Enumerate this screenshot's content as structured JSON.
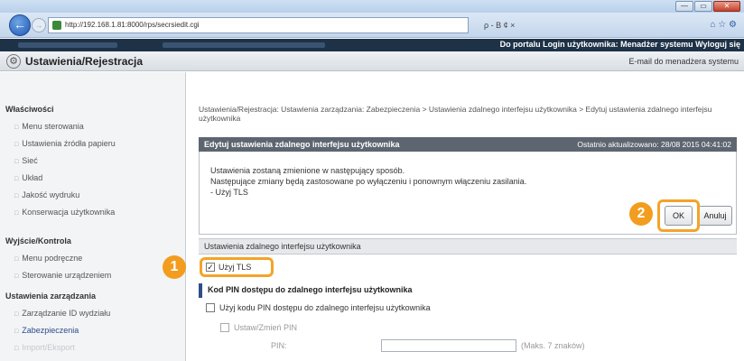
{
  "browser": {
    "url": "http://192.168.1.81:8000/rps/secrsiedit.cgi",
    "search_glyphs": "ρ - B ¢ ×",
    "tab_glyphs": "⌂ ☆ ⚙",
    "window_minimize": "—",
    "window_maximize": "▭",
    "window_close": "✕",
    "back": "←",
    "forward": "→"
  },
  "topbar": {
    "links": "Do portalu  Login użytkownika: Menadżer systemu  Wyloguj się"
  },
  "header": {
    "title": "Ustawienia/Rejestracja",
    "email_link": "E-mail do menadżera systemu"
  },
  "sidebar": {
    "sections": [
      {
        "heading": "Właściwości",
        "items": [
          "Menu sterowania",
          "Ustawienia źródła papieru",
          "Sieć",
          "Układ",
          "Jakość wydruku",
          "Konserwacja użytkownika"
        ]
      },
      {
        "heading": "Wyjście/Kontrola",
        "items": [
          "Menu podręczne",
          "Sterowanie urządzeniem"
        ]
      },
      {
        "heading": "Ustawienia zarządzania",
        "items": [
          "Zarządzanie ID wydziału",
          "Zabezpieczenia",
          "Import/Eksport"
        ]
      }
    ]
  },
  "main": {
    "breadcrumb": "Ustawienia/Rejestracja: Ustawienia zarządzania: Zabezpieczenia > Ustawienia zdalnego interfejsu użytkownika > Edytuj ustawienia zdalnego interfejsu użytkownika",
    "panel_title": "Edytuj ustawienia zdalnego interfejsu użytkownika",
    "last_updated": "Ostatnio aktualizowano: 28/08 2015 04:41:02",
    "message_lines": [
      "Ustawienia zostaną zmienione w następujący sposób.",
      "Następujące zmiany będą zastosowane po wyłączeniu i ponownym włączeniu zasilania.",
      "- Użyj TLS"
    ],
    "ok_label": "OK",
    "cancel_label": "Anuluj",
    "section1_title": "Ustawienia zdalnego interfejsu użytkownika",
    "use_tls_label": "Użyj TLS",
    "use_tls_checked": true,
    "section2_title": "Kod PIN dostępu do zdalnego interfejsu użytkownika",
    "use_pin_label": "Użyj kodu PIN dostępu do zdalnego interfejsu użytkownika",
    "set_pin_label": "Ustaw/Zmień PIN",
    "pin_label": "PIN:",
    "pin_hint": "(Maks. 7 znaków)"
  },
  "callouts": {
    "step1": "1",
    "step2": "2"
  },
  "colors": {
    "accent_orange": "#f29d1f",
    "dark_header": "#1e3247",
    "panel_header": "#5d6670"
  }
}
